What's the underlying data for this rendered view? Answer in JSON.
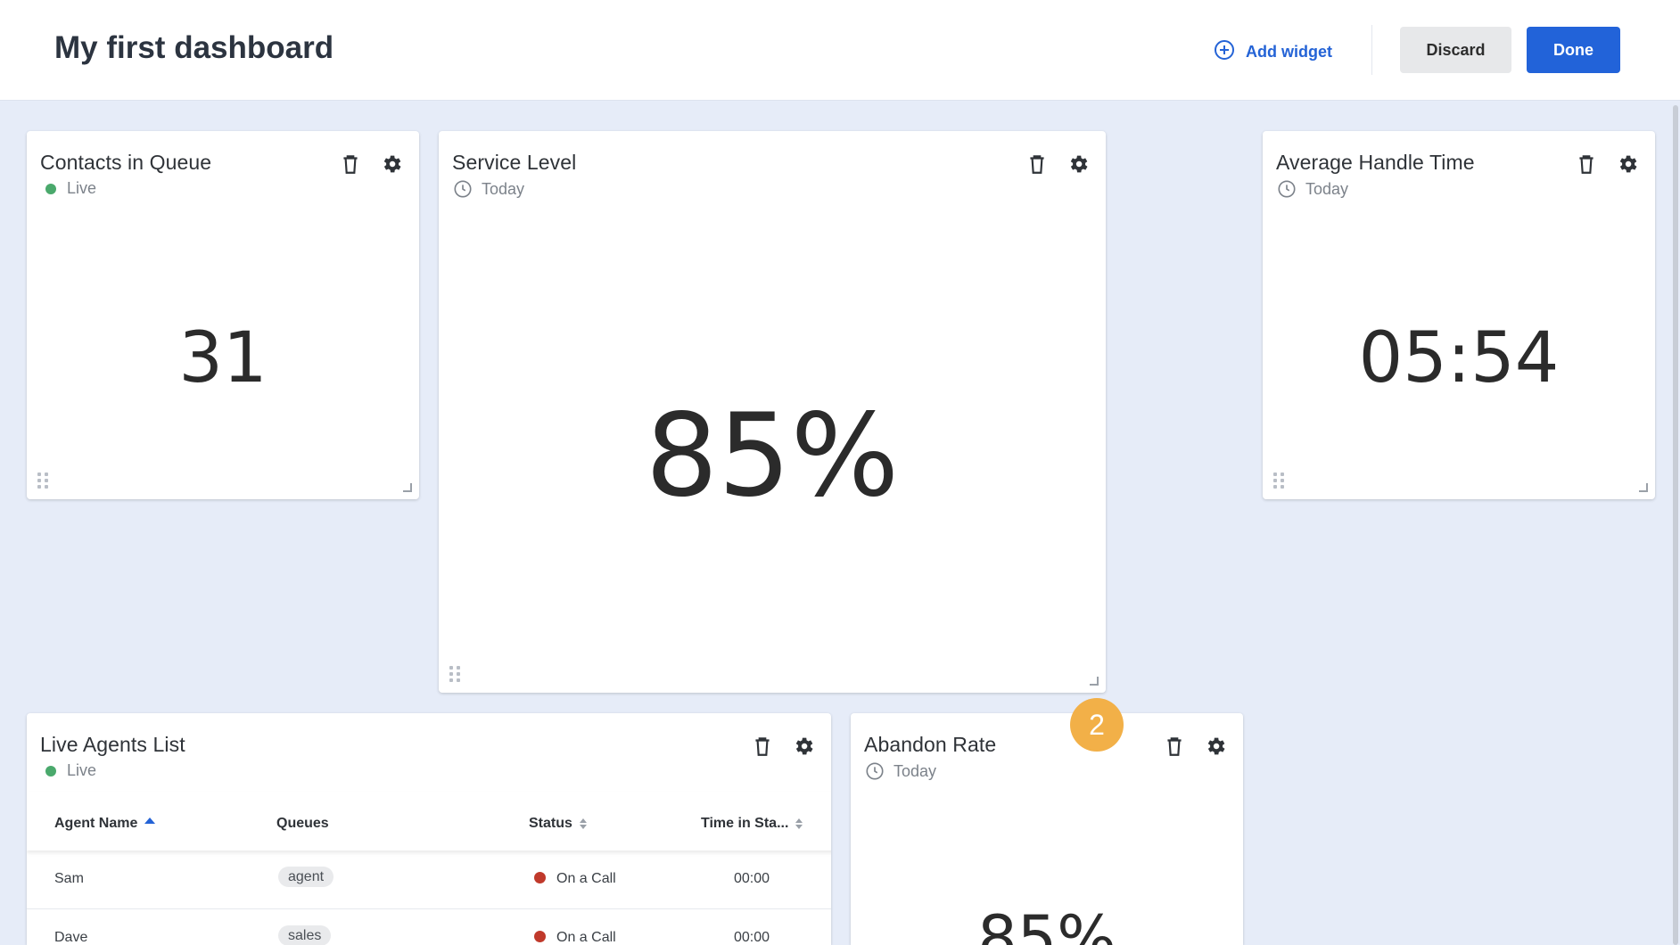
{
  "header": {
    "title": "My first dashboard",
    "add_widget_label": "Add widget",
    "discard_label": "Discard",
    "done_label": "Done"
  },
  "colors": {
    "accent": "#2263d9",
    "live": "#4aa96c",
    "badge": "#f2b048",
    "status_on_call": "#c0392b",
    "background": "#e6ecf8"
  },
  "widgets": {
    "contacts": {
      "title": "Contacts in Queue",
      "subtitle": "Live",
      "value": "31"
    },
    "service": {
      "title": "Service Level",
      "subtitle": "Today",
      "value": "85%"
    },
    "aht": {
      "title": "Average Handle Time",
      "subtitle": "Today",
      "value": "05:54"
    },
    "agents": {
      "title": "Live Agents List",
      "subtitle": "Live",
      "columns": [
        "Agent Name",
        "Queues",
        "Status",
        "Time in Sta..."
      ],
      "rows": [
        {
          "name": "Sam",
          "queue": "agent",
          "status": "On a Call",
          "time": "00:00"
        },
        {
          "name": "Dave",
          "queue": "sales",
          "status": "On a Call",
          "time": "00:00"
        }
      ]
    },
    "abandon": {
      "title": "Abandon Rate",
      "subtitle": "Today",
      "value": "85%"
    }
  },
  "badge": {
    "value": "2"
  },
  "icons": [
    "add-circle-icon",
    "trash-icon",
    "gear-icon",
    "clock-icon",
    "drag-handle-icon",
    "resize-handle-icon",
    "sort-icon"
  ]
}
